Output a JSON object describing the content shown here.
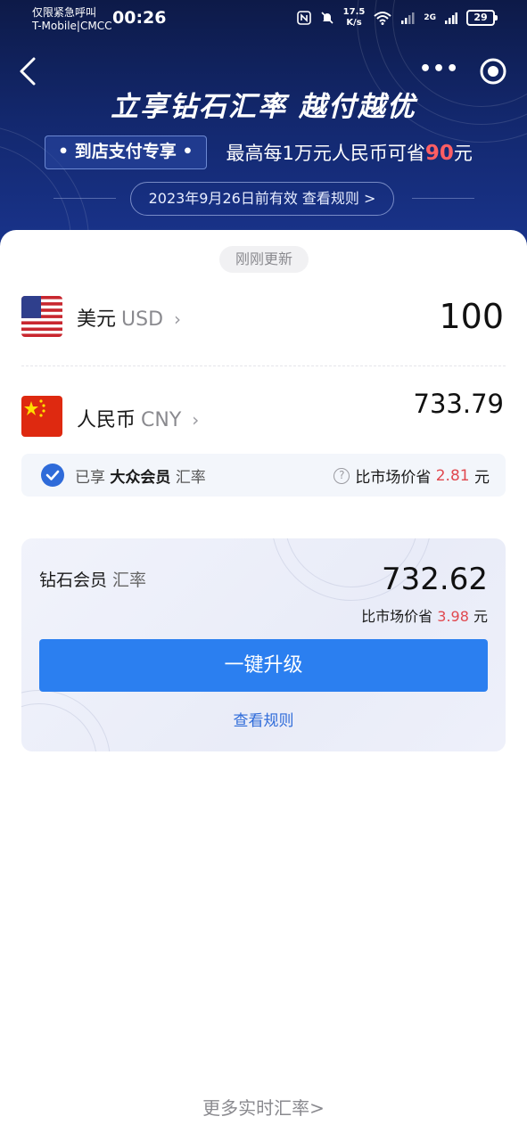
{
  "status_bar": {
    "emergency": "仅限紧急呼叫",
    "carrier": "T-Mobile|CMCC",
    "time": "00:26",
    "speed_value": "17.5",
    "speed_unit": "K/s",
    "network": "2G",
    "battery": "29"
  },
  "banner": {
    "headline": "立享钻石汇率 越付越优",
    "promo_tag": "• 到店支付专享 •",
    "promo_text_prefix": "最高每1万元人民币可省",
    "promo_amount": "90",
    "promo_text_suffix": "元",
    "validity": "2023年9月26日前有效  查看规则 >"
  },
  "converter": {
    "updated_badge": "刚刚更新",
    "from": {
      "name": "美元",
      "code": "USD",
      "amount": "100"
    },
    "to": {
      "name": "人民币",
      "code": "CNY",
      "amount": "733.79"
    }
  },
  "member_rate": {
    "prefix": "已享",
    "tier": "大众会员",
    "suffix": "汇率",
    "save_prefix": "比市场价省",
    "save_amount": "2.81",
    "save_unit": "元"
  },
  "diamond": {
    "tier": "钻石会员",
    "suffix": "汇率",
    "rate": "732.62",
    "save_prefix": "比市场价省",
    "save_amount": "3.98",
    "save_unit": "元",
    "upgrade_label": "一键升级",
    "rules_label": "查看规则"
  },
  "footer": {
    "more_rates": "更多实时汇率>"
  },
  "colors": {
    "primary": "#2b7ff0",
    "accent_red": "#e0484f",
    "banner_bg": "#13286e"
  }
}
